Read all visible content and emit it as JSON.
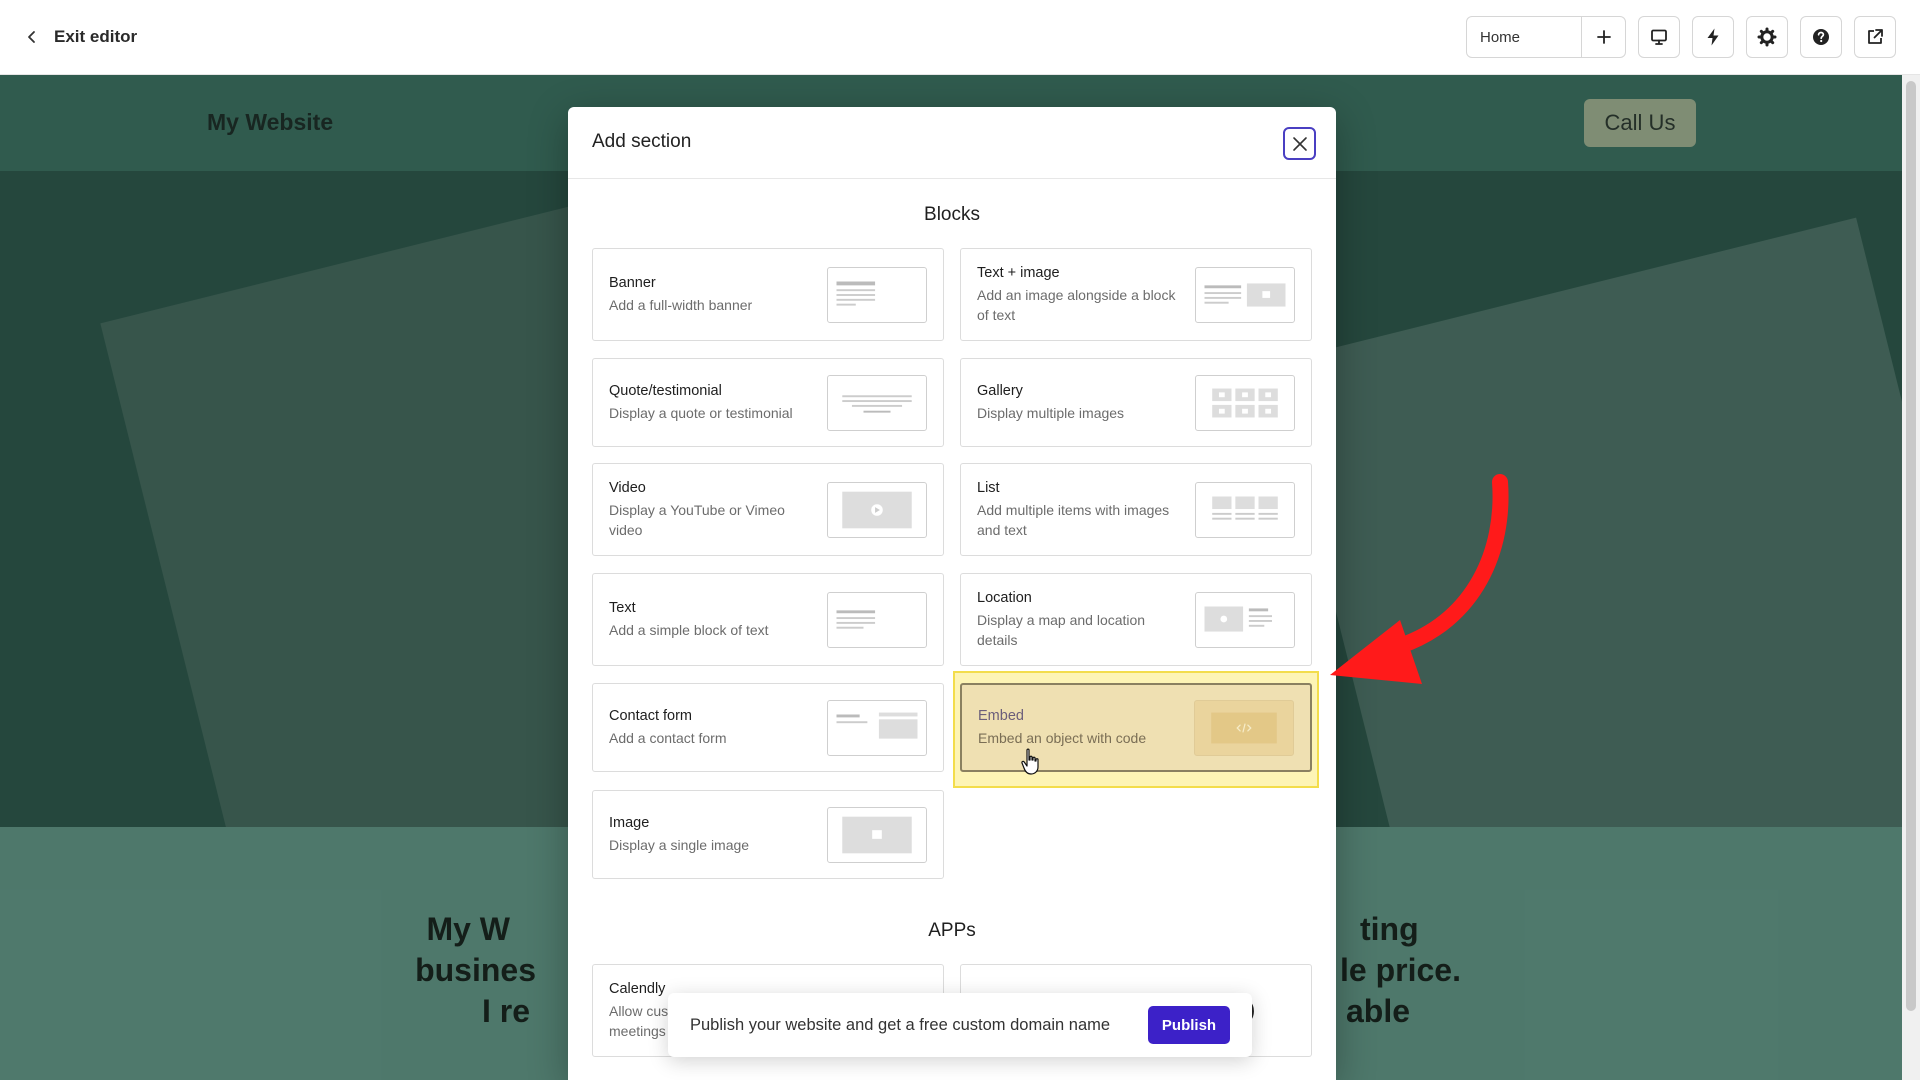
{
  "topbar": {
    "exit_label": "Exit editor",
    "page_name": "Home",
    "icons": [
      "desktop-icon",
      "lightning-icon",
      "gear-icon",
      "help-icon",
      "external-link-icon"
    ]
  },
  "site": {
    "logo": "My Website",
    "call_button": "Call Us",
    "hero_line1_left": "My W",
    "hero_line1_right": "ting",
    "hero_line2_left": "busines",
    "hero_line2_right": "le price.",
    "hero_line3_left": "I re",
    "hero_line3_right": "able"
  },
  "modal": {
    "title": "Add section",
    "blocks_heading": "Blocks",
    "apps_heading": "APPs",
    "blocks": [
      {
        "name": "Banner",
        "desc": "Add a full-width banner"
      },
      {
        "name": "Text + image",
        "desc": "Add an image alongside a block of text"
      },
      {
        "name": "Quote/testimonial",
        "desc": "Display a quote or testimonial"
      },
      {
        "name": "Gallery",
        "desc": "Display multiple images"
      },
      {
        "name": "Video",
        "desc": "Display a YouTube or Vimeo video"
      },
      {
        "name": "List",
        "desc": "Add multiple items with images and text"
      },
      {
        "name": "Text",
        "desc": "Add a simple block of text"
      },
      {
        "name": "Location",
        "desc": "Display a map and location details"
      },
      {
        "name": "Contact form",
        "desc": "Add a contact form"
      },
      {
        "name": "Embed",
        "desc": "Embed an object with code"
      },
      {
        "name": "Image",
        "desc": "Display a single image"
      }
    ],
    "apps": [
      {
        "name": "Calendly",
        "desc": "Allow cus",
        "desc2": "meetings"
      },
      {
        "name": "",
        "desc": ")"
      }
    ]
  },
  "toast": {
    "text": "Publish your website and get a free custom domain name",
    "button": "Publish"
  },
  "colors": {
    "accent": "#3c21c8",
    "highlight": "#f3dd4b",
    "arrow": "#ff1a1a"
  }
}
